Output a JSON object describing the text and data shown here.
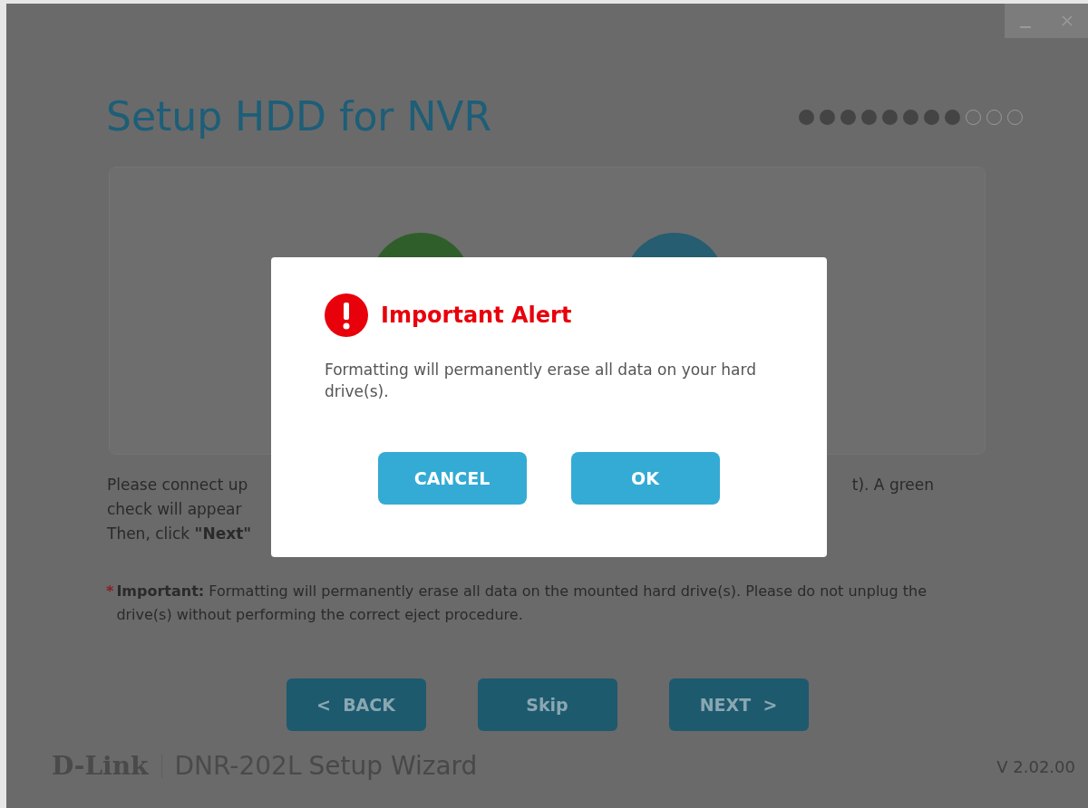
{
  "window": {
    "controls": [
      {
        "kind": "minimize"
      },
      {
        "kind": "close"
      }
    ]
  },
  "wizard": {
    "title": "Setup HDD for NVR",
    "steps": [
      {
        "completed": true
      },
      {
        "completed": true
      },
      {
        "completed": true
      },
      {
        "completed": true
      },
      {
        "completed": true
      },
      {
        "completed": true
      },
      {
        "completed": true
      },
      {
        "completed": true
      },
      {
        "completed": false
      },
      {
        "completed": false
      },
      {
        "completed": false
      }
    ],
    "instructions_left": [
      "Please connect up",
      "check will appear",
      "Then, click **\"Next\"**"
    ],
    "instructions_right": [
      "t). A green"
    ],
    "important_mark": "*",
    "important": "**Important:** Formatting will permanently erase all data on the mounted hard drive(s). Please do not unplug the drive(s) without performing the correct eject procedure.",
    "buttons": [
      "<  BACK",
      "Skip",
      "NEXT  >"
    ]
  },
  "footer": {
    "brand": "D-Link",
    "product": "DNR-202L",
    "product_suffix": "Setup Wizard",
    "version": "V 2.02.00"
  },
  "dialog": {
    "title": "Important Alert",
    "message": "Formatting will permanently erase all data on your hard drive(s).",
    "buttons": [
      "CANCEL",
      "OK"
    ]
  }
}
